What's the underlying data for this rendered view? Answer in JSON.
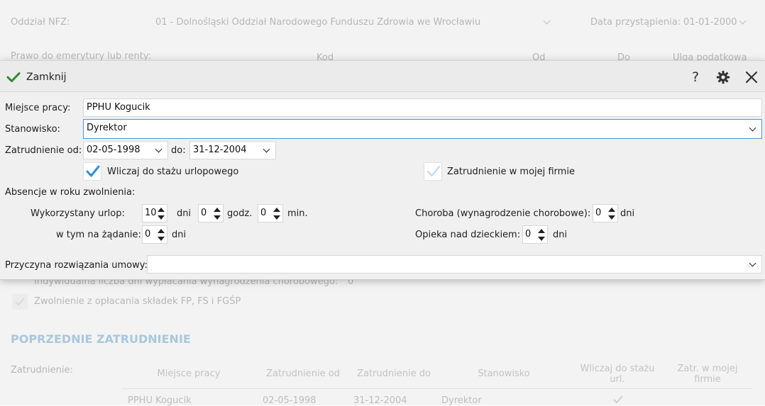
{
  "background": {
    "oddzial_label": "Oddział NFZ:",
    "oddzial_value": "01 - Dolnośląski Oddział Narodowego Funduszu Zdrowia we Wrocławiu",
    "data_przyst_label": "Data przystąpienia:",
    "data_przyst_value": "01-01-2000",
    "prawo_label": "Prawo do emerytury lub renty:",
    "kod_label": "Kod",
    "od_label": "Od",
    "do_label": "Do",
    "ulga_label": "Ulga podatkowa",
    "indywidualna_label": "Indywidualna liczba dni wypłacania wynagrodzenia chorobowego:",
    "indywidualna_value": "0",
    "zwolnienie_label": "Zwolnienie z opłacania składek FP, FS i FGŚP",
    "section_heading": "POPRZEDNIE ZATRUDNIENIE",
    "zatrudnienie_label": "Zatrudnienie:",
    "table": {
      "headers": [
        "Miejsce pracy",
        "Zatrudnienie od",
        "Zatrudnienie do",
        "Stanowisko",
        "Wliczaj do stażu url.",
        "Zatr. w mojej firmie"
      ],
      "row": [
        "PPHU Kogucik",
        "02-05-1998",
        "31-12-2004",
        "Dyrektor"
      ]
    }
  },
  "modal": {
    "close_label": "Zamknij",
    "help_label": "?",
    "miejsce_label": "Miejsce pracy:",
    "miejsce_value": "PPHU Kogucik",
    "stanowisko_label": "Stanowisko:",
    "stanowisko_value": "Dyrektor",
    "zatr_od_label": "Zatrudnienie od:",
    "zatr_od_value": "02-05-1998",
    "do_label": "do:",
    "zatr_do_value": "31-12-2004",
    "wliczaj_label": "Wliczaj do stażu urlopowego",
    "wliczaj_checked": true,
    "w_mojej_label": "Zatrudnienie w mojej firmie",
    "w_mojej_checked": false,
    "absencje_label": "Absencje w roku zwolnienia:",
    "urlop_label": "Wykorzystany urlop:",
    "urlop_dni": "10",
    "dni_unit": "dni",
    "urlop_godz": "0",
    "godz_unit": "godz.",
    "urlop_min": "0",
    "min_unit": "min.",
    "zadanie_label": "w tym na żądanie:",
    "zadanie_dni": "0",
    "choroba_label": "Choroba (wynagrodzenie chorobowe):",
    "choroba_dni": "0",
    "opieka_label": "Opieka nad dzieckiem:",
    "opieka_dni": "0",
    "przyczyna_label": "Przyczyna rozwiązania umowy:",
    "przyczyna_value": ""
  },
  "colors": {
    "check_green": "#2e8b2e",
    "check_faded": "#a9c9e6",
    "focus_blue": "#3b9ed6",
    "heading_faded": "#a9c7dd"
  }
}
